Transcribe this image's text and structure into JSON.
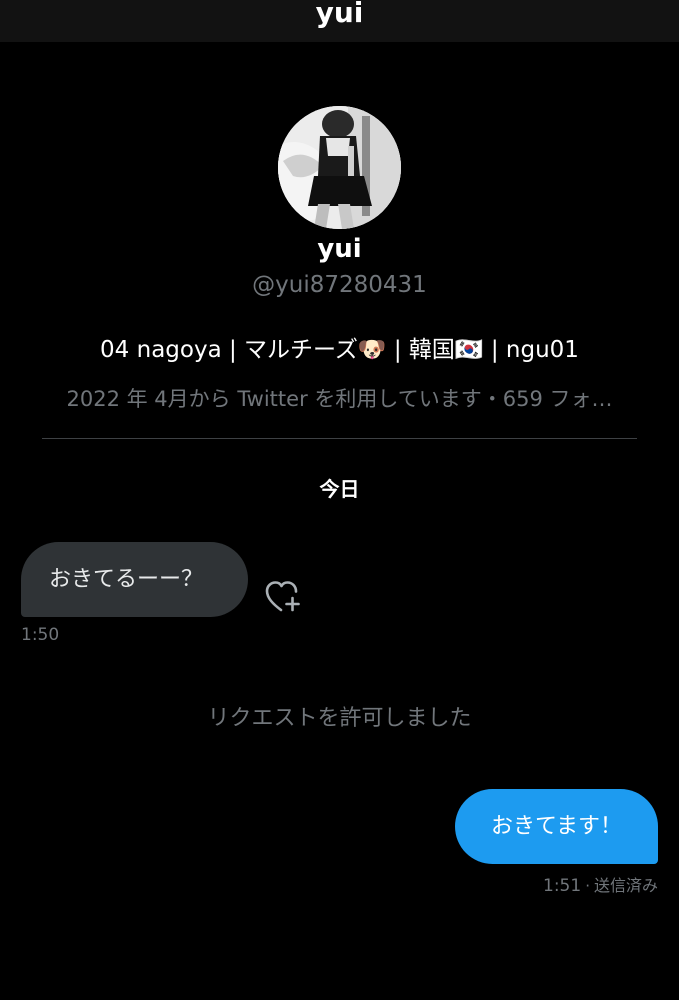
{
  "header": {
    "title": "yui"
  },
  "profile": {
    "avatar_icon": "user-avatar-photo",
    "name": "yui",
    "handle": "@yui87280431",
    "bio": "04 nagoya | マルチーズ🐶 | 韓国🇰🇷 | ngu01",
    "meta": "2022 年 4月から Twitter を利用しています・659 フォ…"
  },
  "conversation": {
    "date_label": "今日",
    "messages": [
      {
        "direction": "received",
        "text": "おきてるーー？",
        "time": "1:50",
        "reaction_icon": "heart-plus-icon"
      },
      {
        "direction": "system",
        "text": "リクエストを許可しました"
      },
      {
        "direction": "sent",
        "text": "おきてます！",
        "time": "1:51",
        "separator": "·",
        "status": "送信済み"
      }
    ]
  },
  "colors": {
    "background": "#000000",
    "header_background": "#121212",
    "sent_bubble": "#1d9bf0",
    "received_bubble": "#2f3336",
    "secondary_text": "#71767b",
    "primary_text": "#ffffff"
  }
}
